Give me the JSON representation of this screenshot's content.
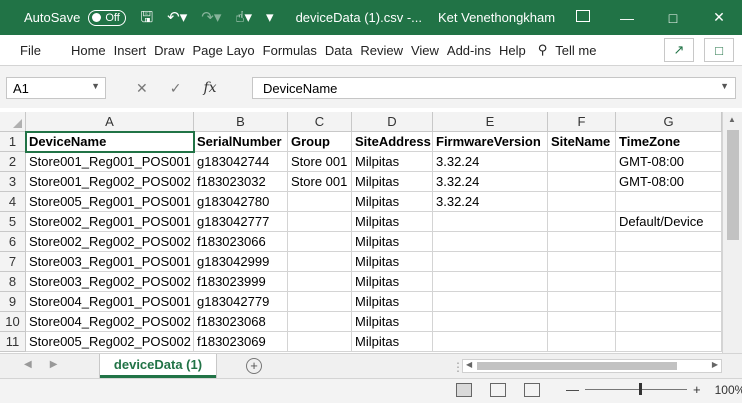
{
  "title_bar": {
    "autosave_label": "AutoSave",
    "autosave_state": "Off",
    "filename": "deviceData (1).csv  -...",
    "user": "Ket Venethongkham"
  },
  "menu": {
    "items": [
      "File",
      "Home",
      "Insert",
      "Draw",
      "Page Layo",
      "Formulas",
      "Data",
      "Review",
      "View",
      "Add-ins",
      "Help"
    ],
    "tell_me": "Tell me"
  },
  "formula_bar": {
    "name_box": "A1",
    "fx_label": "fx",
    "content": "DeviceName"
  },
  "grid": {
    "columns": [
      "A",
      "B",
      "C",
      "D",
      "E",
      "F",
      "G"
    ],
    "rows": [
      [
        "DeviceName",
        "SerialNumber",
        "Group",
        "SiteAddress",
        "FirmwareVersion",
        "SiteName",
        "TimeZone"
      ],
      [
        "Store001_Reg001_POS001",
        "g183042744",
        "Store 001",
        "Milpitas",
        "3.32.24",
        "",
        "GMT-08:00"
      ],
      [
        "Store001_Reg002_POS002",
        "f183023032",
        "Store 001",
        "Milpitas",
        "3.32.24",
        "",
        "GMT-08:00"
      ],
      [
        "Store005_Reg001_POS001",
        "g183042780",
        "",
        "Milpitas",
        "3.32.24",
        "",
        ""
      ],
      [
        "Store002_Reg001_POS001",
        "g183042777",
        "",
        "Milpitas",
        "",
        "",
        "Default/Device"
      ],
      [
        "Store002_Reg002_POS002",
        "f183023066",
        "",
        "Milpitas",
        "",
        "",
        ""
      ],
      [
        "Store003_Reg001_POS001",
        "g183042999",
        "",
        "Milpitas",
        "",
        "",
        ""
      ],
      [
        "Store003_Reg002_POS002",
        "f183023999",
        "",
        "Milpitas",
        "",
        "",
        ""
      ],
      [
        "Store004_Reg001_POS001",
        "g183042779",
        "",
        "Milpitas",
        "",
        "",
        ""
      ],
      [
        "Store004_Reg002_POS002",
        "f183023068",
        "",
        "Milpitas",
        "",
        "",
        ""
      ],
      [
        "Store005_Reg002_POS002",
        "f183023069",
        "",
        "Milpitas",
        "",
        "",
        ""
      ]
    ]
  },
  "sheet_tabs": {
    "active": "deviceData (1)"
  },
  "status_bar": {
    "zoom": "100%"
  }
}
